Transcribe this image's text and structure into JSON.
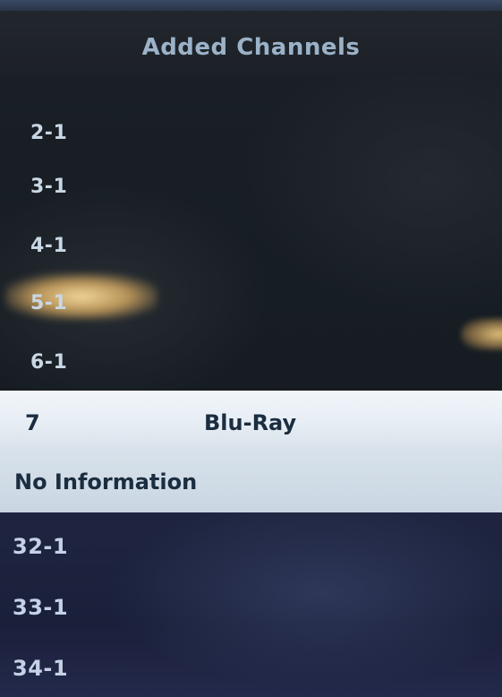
{
  "header": {
    "title": "Added Channels"
  },
  "channels_above": [
    {
      "number": "2-1"
    },
    {
      "number": "3-1"
    },
    {
      "number": "4-1"
    },
    {
      "number": "5-1"
    },
    {
      "number": "6-1"
    }
  ],
  "selected": {
    "number": "7",
    "name": "Blu-Ray",
    "info": "No Information"
  },
  "channels_below": [
    {
      "number": "32-1"
    },
    {
      "number": "33-1"
    },
    {
      "number": "34-1"
    }
  ],
  "colors": {
    "header_text": "#9bb2c8",
    "list_text": "#c9d7e4",
    "selected_bg": "#e6edf4",
    "selected_text": "#1b2d40"
  }
}
